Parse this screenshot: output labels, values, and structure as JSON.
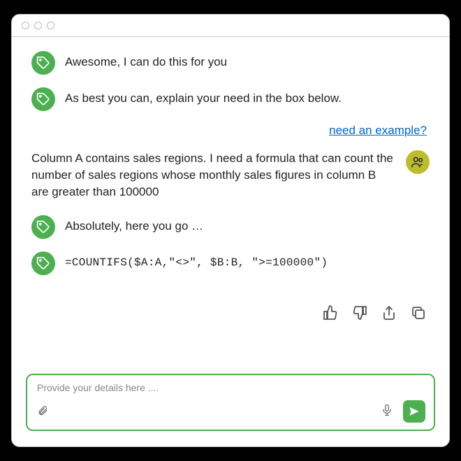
{
  "messages": {
    "bot1": "Awesome, I can do this for you",
    "bot2": "As best you can, explain your need in the box below.",
    "example_link": "need an example?",
    "user1": "Column A contains sales regions.  I need a formula that can count the number of sales regions whose monthly sales figures in column B are greater than 100000",
    "bot3": "Absolutely, here you go …",
    "formula": "=COUNTIFS($A:A,\"<>\", $B:B, \">=100000\")"
  },
  "input": {
    "placeholder": "Provide your details here ...."
  }
}
